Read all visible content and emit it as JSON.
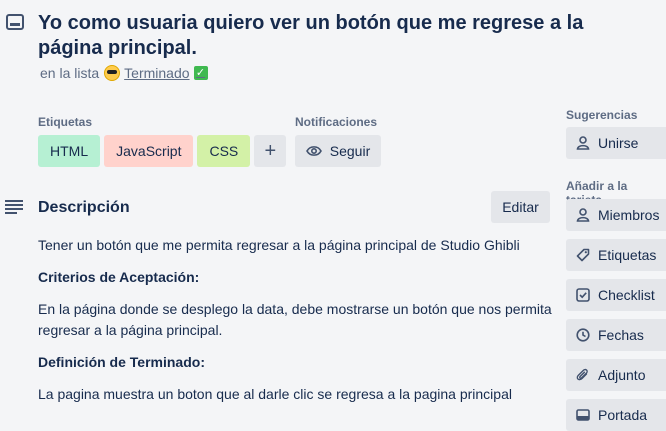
{
  "card": {
    "title": "Yo como usuaria quiero ver un botón que me regrese a la página principal.",
    "list_prefix": "en la lista",
    "list_name": "Terminado",
    "list_emoji_left": "sunglasses-emoji",
    "list_emoji_right": "check-emoji"
  },
  "labels": {
    "heading": "Etiquetas",
    "items": [
      {
        "text": "HTML",
        "color": "#b6f0d3"
      },
      {
        "text": "JavaScript",
        "color": "#ffd2cc"
      },
      {
        "text": "CSS",
        "color": "#d3f1a7"
      }
    ],
    "add_symbol": "+"
  },
  "notifications": {
    "heading": "Notificaciones",
    "follow_label": "Seguir"
  },
  "description": {
    "heading": "Descripción",
    "edit_label": "Editar",
    "paragraphs": [
      "Tener un botón que me permita regresar a la página principal de Studio Ghibli",
      "Criterios de Aceptación:",
      "En la página donde se desplego la data, debe mostrarse un botón que nos permita regresar a la página principal.",
      "Definición de Terminado:",
      "La pagina muestra un boton que al darle clic se regresa a la pagina principal"
    ]
  },
  "sidebar": {
    "suggestions_heading": "Sugerencias",
    "join_label": "Unirse",
    "add_heading": "Añadir a la tarjeta",
    "items": [
      {
        "label": "Miembros",
        "icon": "person-icon"
      },
      {
        "label": "Etiquetas",
        "icon": "tag-icon"
      },
      {
        "label": "Checklist",
        "icon": "checklist-icon"
      },
      {
        "label": "Fechas",
        "icon": "clock-icon"
      },
      {
        "label": "Adjunto",
        "icon": "paperclip-icon"
      },
      {
        "label": "Portada",
        "icon": "cover-icon"
      }
    ]
  },
  "colors": {
    "background": "#f4f5f7",
    "text": "#172b4d",
    "muted": "#5e6c84",
    "button_bg": "#e4e6ea"
  }
}
